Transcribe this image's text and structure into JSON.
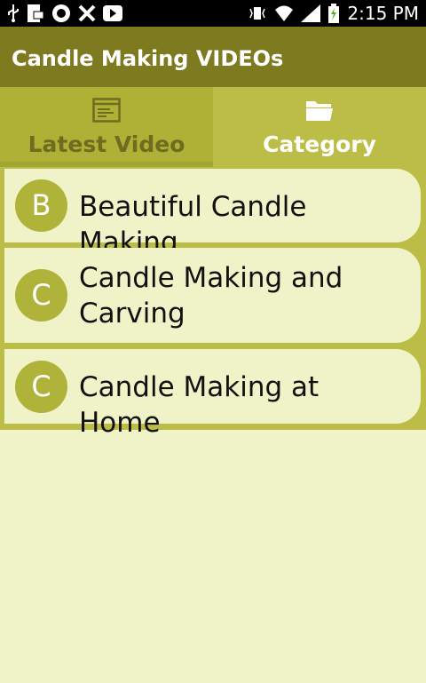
{
  "status_bar": {
    "time": "2:15 PM",
    "left_icons": [
      "usb-icon",
      "file-icon",
      "app-icon",
      "x-app-icon",
      "youtube-icon"
    ],
    "right_icons": [
      "vibrate-icon",
      "wifi-icon",
      "signal-icon",
      "battery-icon"
    ]
  },
  "app_bar": {
    "title": "Candle Making VIDEOs"
  },
  "tabs": [
    {
      "label": "Latest Video",
      "icon": "list-window-icon",
      "active": true
    },
    {
      "label": "Category",
      "icon": "folder-icon",
      "active": false
    }
  ],
  "list": {
    "items": [
      {
        "letter": "B",
        "title": "Beautiful Candle Making"
      },
      {
        "letter": "C",
        "title_line1": "Candle Making and",
        "title_line2": "Carving"
      },
      {
        "letter": "C",
        "title": "Candle Making at Home"
      }
    ]
  },
  "colors": {
    "app_bar": "#7e7a1f",
    "tab_bar": "#bcbd47",
    "active_tab": "#afb137",
    "circle": "#b0b33a",
    "background": "#f0f2c8"
  }
}
